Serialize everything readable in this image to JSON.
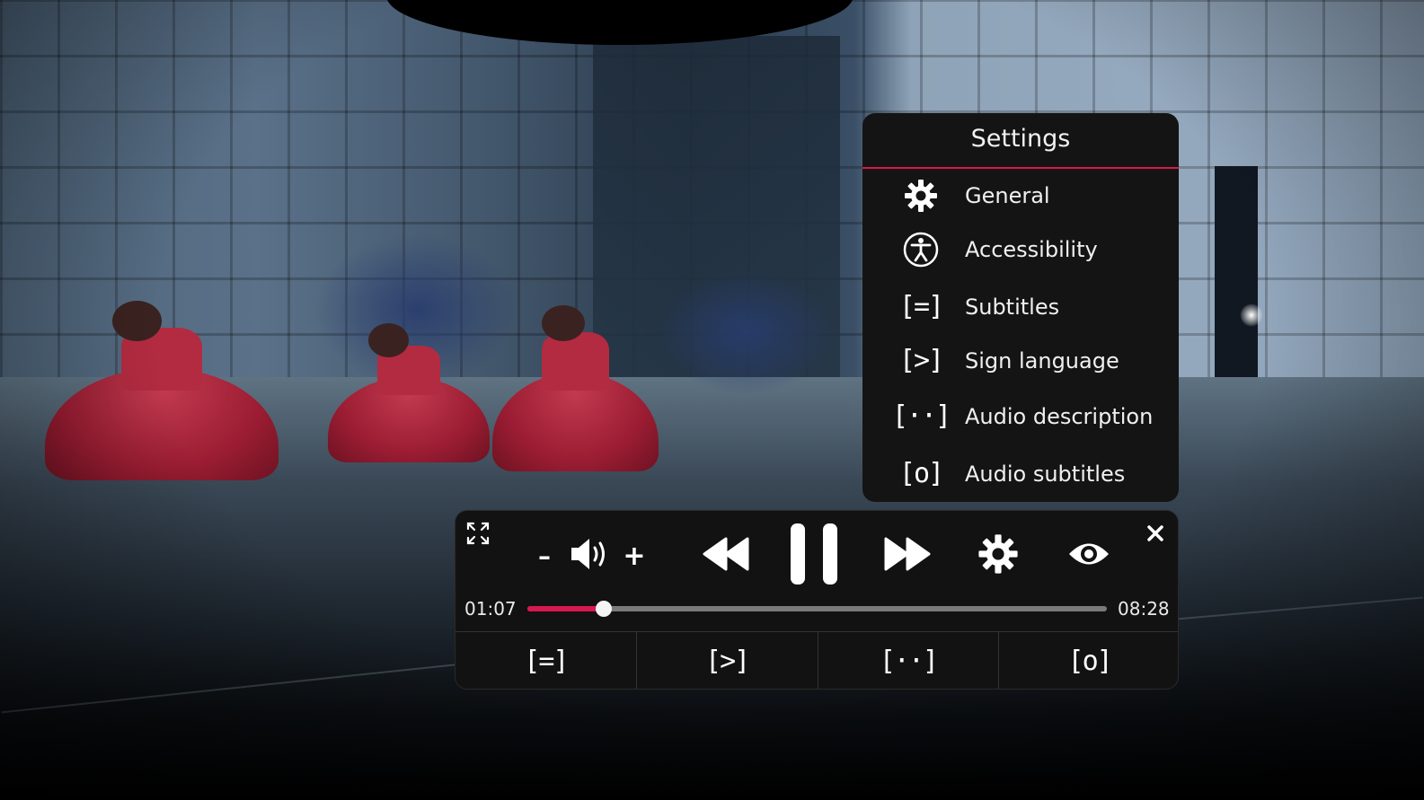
{
  "settings": {
    "title": "Settings",
    "items": [
      {
        "label": "General",
        "icon": "gear-icon"
      },
      {
        "label": "Accessibility",
        "icon": "accessibility-icon"
      },
      {
        "label": "Subtitles",
        "icon": "[=]"
      },
      {
        "label": "Sign language",
        "icon": "[>]"
      },
      {
        "label": "Audio description",
        "icon": "[··]"
      },
      {
        "label": "Audio subtitles",
        "icon": "[o]"
      }
    ]
  },
  "player": {
    "volume_down": "–",
    "volume_up": "+",
    "current_time": "01:07",
    "duration": "08:28",
    "progress": 0.132,
    "accent_color": "#d7194f",
    "quick_buttons": [
      "[=]",
      "[>]",
      "[··]",
      "[o]"
    ]
  }
}
